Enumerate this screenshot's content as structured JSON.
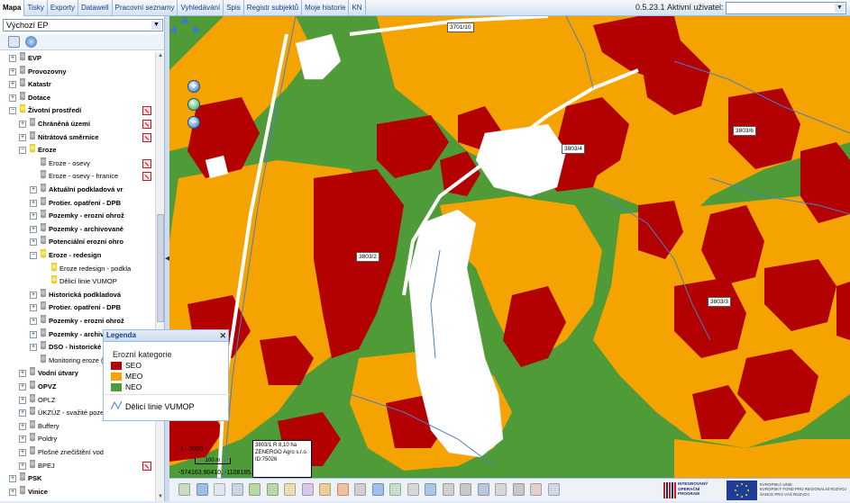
{
  "menu": [
    "Mapa",
    "Tisky",
    "Exporty",
    "Datawell",
    "Pracovní seznamy",
    "Vyhledávání",
    "Spis",
    "Registr subjektů",
    "Moje historie",
    "KN"
  ],
  "version": "0.5.23.1",
  "user_label": "Aktivní uživatel:",
  "user_value": "",
  "ep_select": "Výchozí EP",
  "tree": [
    {
      "label": "EVP",
      "bold": true,
      "level": 0,
      "bulb": "g",
      "red": false
    },
    {
      "label": "Provozovny",
      "bold": true,
      "level": 0,
      "bulb": "g",
      "red": false
    },
    {
      "label": "Katastr",
      "bold": true,
      "level": 0,
      "bulb": "g",
      "red": false
    },
    {
      "label": "Dotace",
      "bold": true,
      "level": 0,
      "bulb": "g",
      "red": false
    },
    {
      "label": "Životní prostředí",
      "bold": true,
      "level": 0,
      "bulb": "y",
      "red": true,
      "open": true
    },
    {
      "label": "Chráněná území",
      "bold": true,
      "level": 1,
      "bulb": "g",
      "red": true
    },
    {
      "label": "Nitrátová směrnice",
      "bold": true,
      "level": 1,
      "bulb": "g",
      "red": true
    },
    {
      "label": "Eroze",
      "bold": true,
      "level": 1,
      "bulb": "y",
      "red": false,
      "open": true
    },
    {
      "label": "Eroze - osevy",
      "bold": false,
      "level": 2,
      "bulb": "g",
      "red": true
    },
    {
      "label": "Eroze - osevy - hranice",
      "bold": false,
      "level": 2,
      "bulb": "g",
      "red": true
    },
    {
      "label": "Aktuální podkladová vr",
      "bold": true,
      "level": 2,
      "bulb": "g",
      "red": false,
      "exp": true
    },
    {
      "label": "Protier. opatření - DPB",
      "bold": true,
      "level": 2,
      "bulb": "g",
      "red": false,
      "exp": true
    },
    {
      "label": "Pozemky - erozní ohrož",
      "bold": true,
      "level": 2,
      "bulb": "g",
      "red": false,
      "exp": true
    },
    {
      "label": "Pozemky - archivované",
      "bold": true,
      "level": 2,
      "bulb": "g",
      "red": false,
      "exp": true
    },
    {
      "label": "Potenciální erozní ohro",
      "bold": true,
      "level": 2,
      "bulb": "g",
      "red": false,
      "exp": true
    },
    {
      "label": "Eroze - redesign",
      "bold": true,
      "level": 2,
      "bulb": "y",
      "red": false,
      "exp": true,
      "open": true
    },
    {
      "label": "Eroze redesign - podkla",
      "bold": false,
      "level": 3,
      "bulb": "y",
      "red": false
    },
    {
      "label": "Dělicí linie VUMOP",
      "bold": false,
      "level": 3,
      "bulb": "y",
      "red": false
    },
    {
      "label": "Historická podkladová",
      "bold": true,
      "level": 2,
      "bulb": "g",
      "red": false,
      "exp": true
    },
    {
      "label": "Protier. opatření - DPB",
      "bold": true,
      "level": 2,
      "bulb": "g",
      "red": false,
      "exp": true
    },
    {
      "label": "Pozemky - erozní ohrož",
      "bold": true,
      "level": 2,
      "bulb": "g",
      "red": false,
      "exp": true
    },
    {
      "label": "Pozemky - archivova",
      "bold": true,
      "level": 2,
      "bulb": "g",
      "red": false,
      "exp": true
    },
    {
      "label": "DSO - historické d",
      "bold": true,
      "level": 2,
      "bulb": "g",
      "red": false,
      "exp": true
    },
    {
      "label": "Monitoring eroze (WF",
      "bold": false,
      "level": 2,
      "bulb": "g",
      "red": false
    },
    {
      "label": "Vodní útvary",
      "bold": true,
      "level": 1,
      "bulb": "g",
      "red": false
    },
    {
      "label": "OPVZ",
      "bold": true,
      "level": 1,
      "bulb": "g",
      "red": false
    },
    {
      "label": "OPLZ",
      "bold": false,
      "level": 1,
      "bulb": "g",
      "red": false
    },
    {
      "label": "ÚKZÚZ - svažité pozemk",
      "bold": false,
      "level": 1,
      "bulb": "g",
      "red": false
    },
    {
      "label": "Buffery",
      "bold": false,
      "level": 1,
      "bulb": "g",
      "red": false
    },
    {
      "label": "Poldry",
      "bold": false,
      "level": 1,
      "bulb": "g",
      "red": false
    },
    {
      "label": "Plošné znečištění vod",
      "bold": false,
      "level": 1,
      "bulb": "g",
      "red": false
    },
    {
      "label": "BPEJ",
      "bold": false,
      "level": 1,
      "bulb": "g",
      "red": true
    },
    {
      "label": "PSK",
      "bold": true,
      "level": 0,
      "bulb": "g",
      "red": false
    },
    {
      "label": "Vinice",
      "bold": true,
      "level": 0,
      "bulb": "g",
      "red": false
    }
  ],
  "parcels": [
    "3701/10",
    "3803/4",
    "3803/6",
    "3803/2",
    "3803/3"
  ],
  "legend": {
    "title": "Legenda",
    "category": "Erozní kategorie",
    "items": [
      {
        "label": "SEO",
        "color": "#b30000"
      },
      {
        "label": "MEO",
        "color": "#f5a300"
      },
      {
        "label": "NEO",
        "color": "#4e9b37"
      }
    ],
    "line_label": "Dělicí linie VUMOP"
  },
  "scale_text": "1 : 3000",
  "scalebar_text": "100 m",
  "coords": "-574163.90410, -1108185.92705",
  "info": {
    "line1": "3803/1 R 8,10 ha",
    "line2": "ZENERGO Agro s.r.o.",
    "line3": "ID:75026"
  },
  "logo1": {
    "line1": "INTEGROVANÝ",
    "line2": "OPERAČNÍ",
    "line3": "PROGRAM"
  },
  "logo2": {
    "line1": "EVROPSKÁ UNIE",
    "line2": "EVROPSKÝ FOND PRO REGIONÁLNÍ ROZVOJ",
    "line3": "ŠANCE PRO VÁŠ ROZVOJ"
  },
  "colors": {
    "seo": "#b30000",
    "meo": "#f5a300",
    "neo": "#4e9b37",
    "river": "#ffffff",
    "line": "#4b7fc4"
  }
}
